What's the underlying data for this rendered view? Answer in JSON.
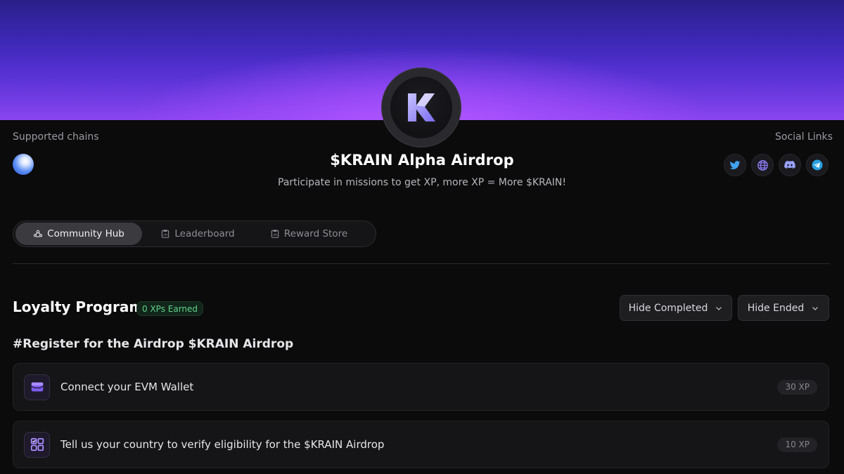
{
  "header": {
    "supported_chains_label": "Supported chains",
    "social_links_label": "Social Links",
    "title": "$KRAIN Alpha Airdrop",
    "subtitle": "Participate in missions to get XP, more XP = More $KRAIN!",
    "logo_letter": "K",
    "socials": [
      {
        "name": "twitter-icon"
      },
      {
        "name": "globe-icon"
      },
      {
        "name": "discord-icon"
      },
      {
        "name": "telegram-icon"
      }
    ]
  },
  "tabs": [
    {
      "label": "Community Hub",
      "active": true
    },
    {
      "label": "Leaderboard",
      "active": false
    },
    {
      "label": "Reward Store",
      "active": false
    }
  ],
  "loyalty": {
    "title": "Loyalty Program",
    "xp_earned": "0 XPs Earned",
    "hide_completed_label": "Hide Completed",
    "hide_ended_label": "Hide Ended"
  },
  "group": {
    "title": "#Register for the Airdrop $KRAIN Airdrop",
    "missions": [
      {
        "label": "Connect your EVM Wallet",
        "xp": "30 XP",
        "icon": "wallet-icon"
      },
      {
        "label": "Tell us your country to verify eligibility for the $KRAIN Airdrop",
        "xp": "10 XP",
        "icon": "grid-icon"
      }
    ]
  },
  "colors": {
    "accent": "#8b5cf6",
    "xp_green": "#5fd38a",
    "background": "#0b0b0c"
  }
}
